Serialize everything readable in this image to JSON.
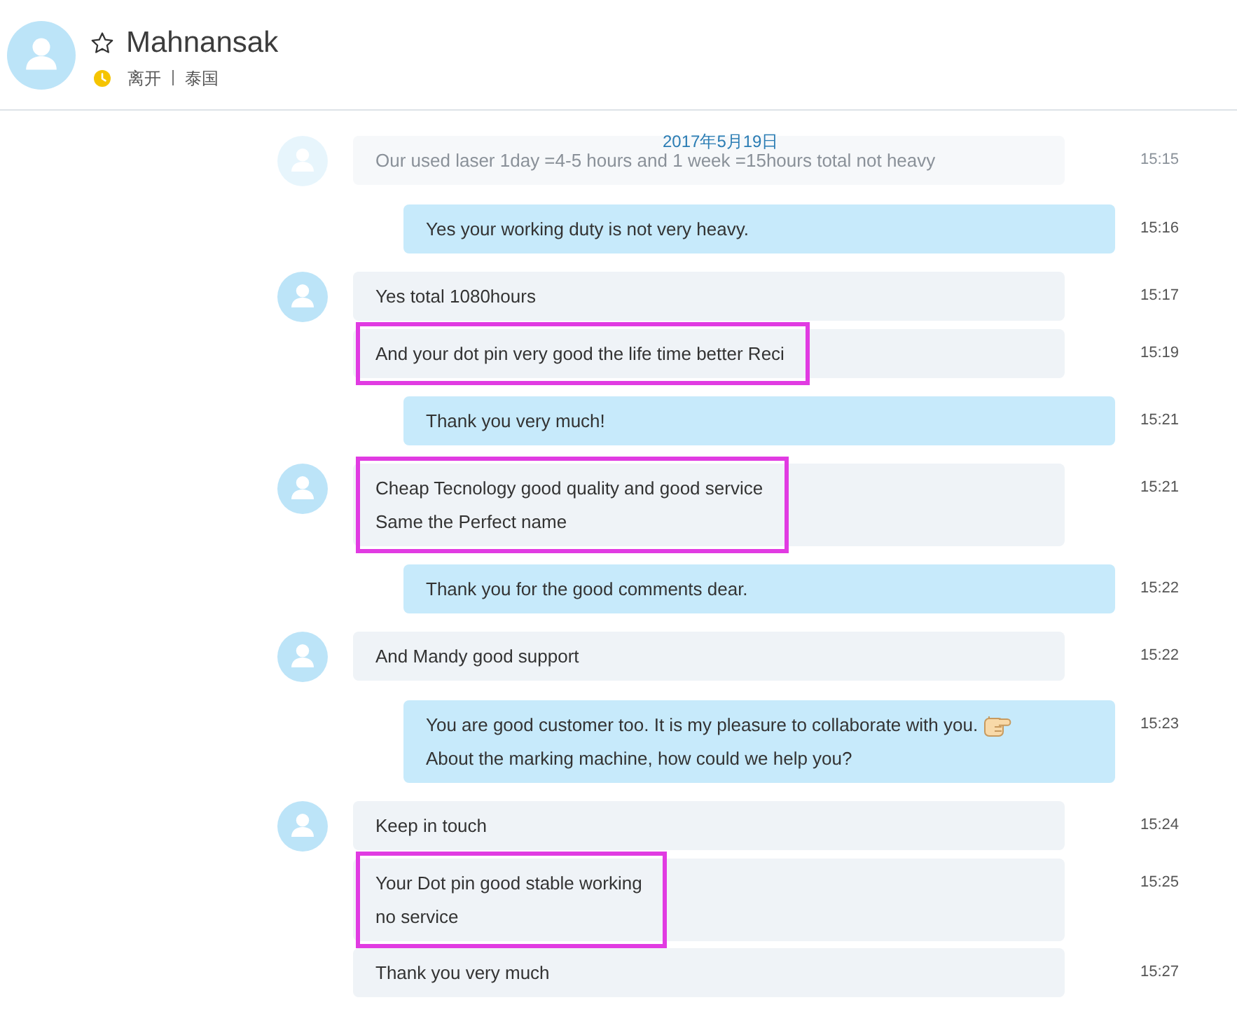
{
  "contact": {
    "name": "Mahnansak",
    "favorite": false,
    "status": "离开",
    "location": "泰国"
  },
  "chat": {
    "date": "2017年5月19日",
    "messages": [
      {
        "kind": "incoming",
        "avatar": true,
        "faded": true,
        "highlighted": false,
        "emoticon": false,
        "lines": [
          "Our used laser 1day =4-5 hours and 1 week =15hours total not heavy"
        ],
        "time": "15:15"
      },
      {
        "kind": "outgoing",
        "avatar": false,
        "faded": false,
        "highlighted": false,
        "emoticon": false,
        "lines": [
          "Yes your working duty is not very heavy."
        ],
        "time": "15:16"
      },
      {
        "kind": "incoming",
        "avatar": true,
        "faded": false,
        "highlighted": false,
        "emoticon": false,
        "lines": [
          "Yes total 1080hours"
        ],
        "time": "15:17"
      },
      {
        "kind": "incoming",
        "avatar": false,
        "faded": false,
        "highlighted": true,
        "emoticon": false,
        "lines": [
          "And your dot pin very good the life time better Reci"
        ],
        "time": "15:19"
      },
      {
        "kind": "outgoing",
        "avatar": false,
        "faded": false,
        "highlighted": false,
        "emoticon": false,
        "lines": [
          "Thank you very much!"
        ],
        "time": "15:21"
      },
      {
        "kind": "incoming",
        "avatar": true,
        "faded": false,
        "highlighted": true,
        "emoticon": false,
        "lines": [
          "Cheap Tecnology good quality and good service",
          "Same the Perfect name"
        ],
        "time": "15:21"
      },
      {
        "kind": "outgoing",
        "avatar": false,
        "faded": false,
        "highlighted": false,
        "emoticon": false,
        "lines": [
          "Thank you for the good comments dear."
        ],
        "time": "15:22"
      },
      {
        "kind": "incoming",
        "avatar": true,
        "faded": false,
        "highlighted": false,
        "emoticon": false,
        "lines": [
          "And Mandy good support"
        ],
        "time": "15:22"
      },
      {
        "kind": "outgoing",
        "avatar": false,
        "faded": false,
        "highlighted": false,
        "emoticon": true,
        "lines": [
          "You are good customer too. It is my pleasure to collaborate with you.",
          "About the marking machine, how could we help you?"
        ],
        "time": "15:23"
      },
      {
        "kind": "incoming",
        "avatar": true,
        "faded": false,
        "highlighted": false,
        "emoticon": false,
        "lines": [
          "Keep in touch"
        ],
        "time": "15:24"
      },
      {
        "kind": "incoming",
        "avatar": false,
        "faded": false,
        "highlighted": true,
        "emoticon": false,
        "lines": [
          "Your Dot pin good stable working",
          "no service"
        ],
        "time": "15:25"
      },
      {
        "kind": "incoming",
        "avatar": false,
        "faded": false,
        "highlighted": false,
        "emoticon": false,
        "lines": [
          "Thank you very much"
        ],
        "time": "15:27"
      }
    ]
  }
}
